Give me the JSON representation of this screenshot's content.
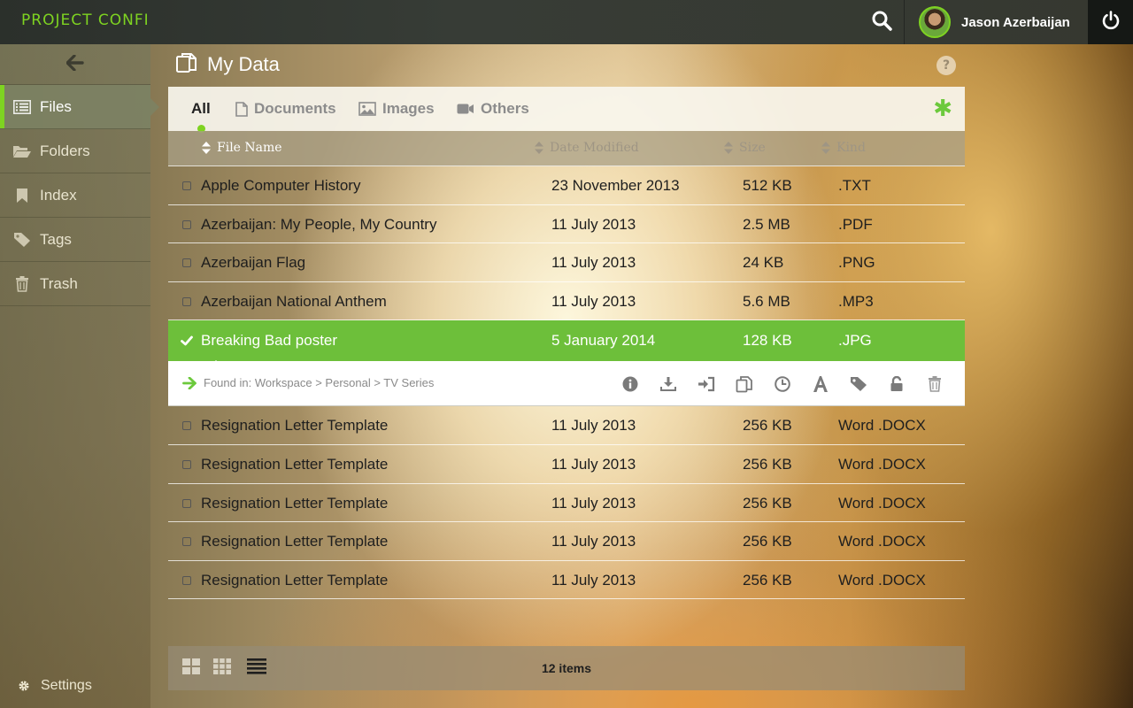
{
  "app": {
    "logo": "PROJECT CONFI"
  },
  "topbar": {
    "search_icon": "search-icon",
    "user_name": "Jason Azerbaijan",
    "power_icon": "power-icon"
  },
  "sidebar": {
    "items": [
      {
        "label": "Files",
        "icon": "list-icon",
        "active": true
      },
      {
        "label": "Folders",
        "icon": "folder-open-icon",
        "active": false
      },
      {
        "label": "Index",
        "icon": "bookmark-icon",
        "active": false
      },
      {
        "label": "Tags",
        "icon": "tag-icon",
        "active": false
      },
      {
        "label": "Trash",
        "icon": "trash-icon",
        "active": false
      }
    ],
    "settings_label": "Settings"
  },
  "page": {
    "title": "My Data",
    "help": "?"
  },
  "tabs": [
    {
      "label": "All",
      "active": true
    },
    {
      "label": "Documents",
      "icon": "document-icon"
    },
    {
      "label": "Images",
      "icon": "image-icon"
    },
    {
      "label": "Others",
      "icon": "video-camera-icon"
    }
  ],
  "tabs_action": "✱",
  "table": {
    "headers": {
      "name": "File Name",
      "date": "Date Modified",
      "size": "Size",
      "kind": "Kind"
    },
    "rows_before": [
      {
        "name": "Apple Computer History",
        "date": "23 November 2013",
        "size": "512 KB",
        "kind": ".TXT"
      },
      {
        "name": "Azerbaijan: My People, My Country",
        "date": "11 July 2013",
        "size": "2.5 MB",
        "kind": ".PDF"
      },
      {
        "name": "Azerbaijan Flag",
        "date": "11 July 2013",
        "size": "24 KB",
        "kind": ".PNG"
      },
      {
        "name": "Azerbaijan National Anthem",
        "date": "11 July 2013",
        "size": "5.6 MB",
        "kind": ".MP3"
      }
    ],
    "selected": {
      "name": "Breaking Bad poster",
      "date": "5 January 2014",
      "size": "128 KB",
      "kind": ".JPG"
    },
    "detail": {
      "found_in": "Found in: Workspace > Personal > TV Series"
    },
    "rows_after": [
      {
        "name": "Resignation Letter Template",
        "date": "11 July 2013",
        "size": "256 KB",
        "kind": "Word .DOCX"
      },
      {
        "name": "Resignation Letter Template",
        "date": "11 July 2013",
        "size": "256 KB",
        "kind": "Word .DOCX"
      },
      {
        "name": "Resignation Letter Template",
        "date": "11 July 2013",
        "size": "256 KB",
        "kind": "Word .DOCX"
      },
      {
        "name": "Resignation Letter Template",
        "date": "11 July 2013",
        "size": "256 KB",
        "kind": "Word .DOCX"
      },
      {
        "name": "Resignation Letter Template",
        "date": "11 July 2013",
        "size": "256 KB",
        "kind": "Word .DOCX"
      }
    ]
  },
  "footer": {
    "items_count": "12 items"
  },
  "colors": {
    "accent": "#7ed321",
    "selected_row": "#6dbf3a",
    "topbar": "#2f3430"
  }
}
